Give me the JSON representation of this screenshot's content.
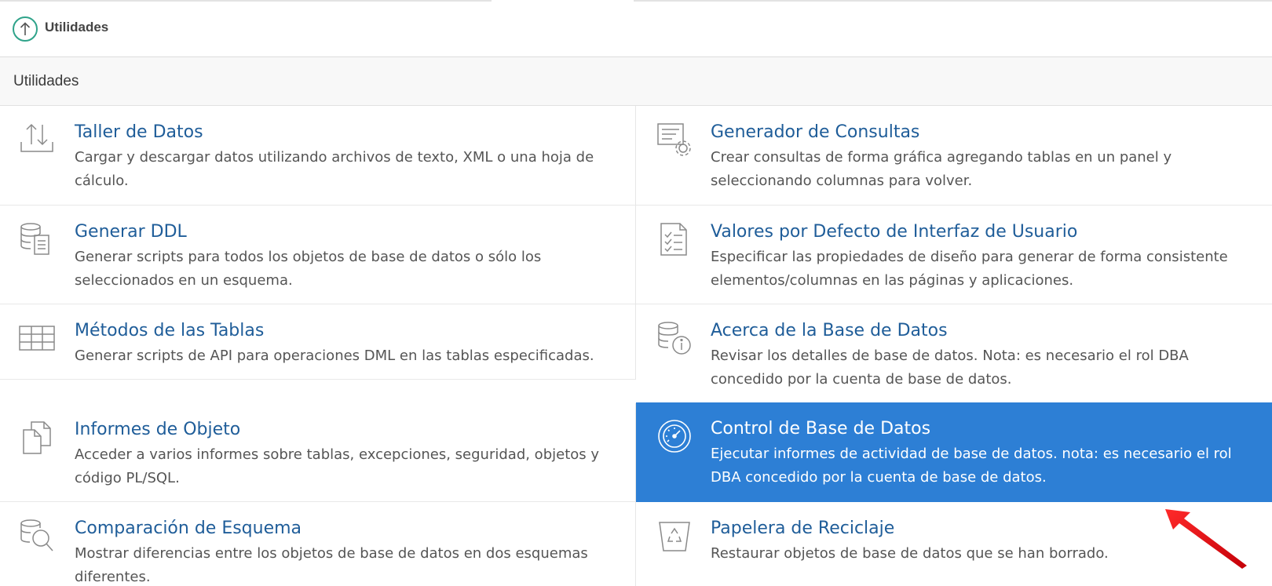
{
  "breadcrumb": {
    "label": "Utilidades",
    "icon": "arrow-up-circle-icon"
  },
  "region": {
    "title": "Utilidades"
  },
  "colors": {
    "link": "#1f5d99",
    "selected_bg": "#2d7fd5",
    "accent_green": "#2fa38a",
    "annotation_red": "#e0141a"
  },
  "utilities": [
    {
      "icon": "upload-download-icon",
      "title": "Taller de Datos",
      "description": "Cargar y descargar datos utilizando archivos de texto, XML o una hoja de cálculo."
    },
    {
      "icon": "query-builder-icon",
      "title": "Generador de Consultas",
      "description": "Crear consultas de forma gráfica agregando tablas en un panel y seleccionando columnas para volver."
    },
    {
      "icon": "database-script-icon",
      "title": "Generar DDL",
      "description": "Generar scripts para todos los objetos de base de datos o sólo los seleccionados en un esquema."
    },
    {
      "icon": "checklist-icon",
      "title": "Valores por Defecto de Interfaz de Usuario",
      "description": "Especificar las propiedades de diseño para generar de forma consistente elementos/columnas en las páginas y aplicaciones."
    },
    {
      "icon": "table-grid-icon",
      "title": "Métodos de las Tablas",
      "description": "Generar scripts de API para operaciones DML en las tablas especificadas."
    },
    {
      "icon": "database-info-icon",
      "title": "Acerca de la Base de Datos",
      "description": "Revisar los detalles de base de datos. Nota: es necesario el rol DBA concedido por la cuenta de base de datos."
    },
    {
      "icon": "documents-icon",
      "title": "Informes de Objeto",
      "description": "Acceder a varios informes sobre tablas, excepciones, seguridad, objetos y código PL/SQL."
    },
    {
      "icon": "gauge-icon",
      "title": "Control de Base de Datos",
      "description": "Ejecutar informes de actividad de base de datos. nota: es necesario el rol DBA concedido por la cuenta de base de datos.",
      "selected": true
    },
    {
      "icon": "database-search-icon",
      "title": "Comparación de Esquema",
      "description": "Mostrar diferencias entre los objetos de base de datos en dos esquemas diferentes."
    },
    {
      "icon": "recycle-bin-icon",
      "title": "Papelera de Reciclaje",
      "description": "Restaurar objetos de base de datos que se han borrado."
    }
  ]
}
